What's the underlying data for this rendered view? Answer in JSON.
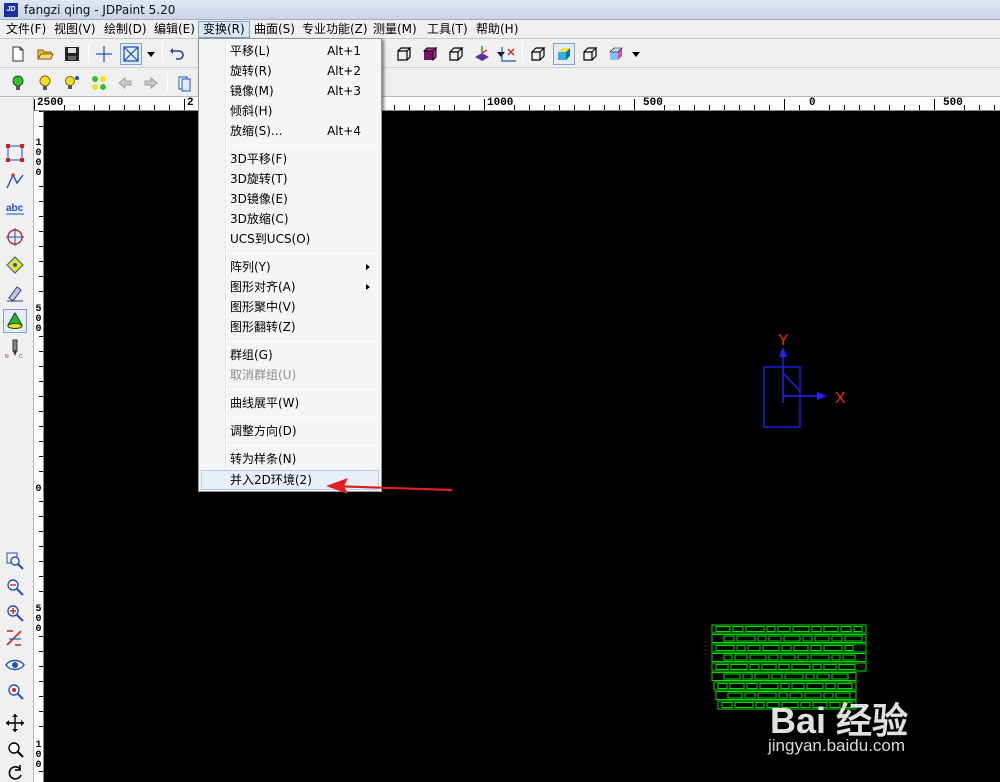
{
  "window": {
    "title": "fangzi qing - JDPaint 5.20",
    "app_icon_text": "JD"
  },
  "menubar": {
    "items": [
      {
        "label": "文件(F)"
      },
      {
        "label": "视图(V)"
      },
      {
        "label": "绘制(D)"
      },
      {
        "label": "编辑(E)"
      },
      {
        "label": "变换(R)"
      },
      {
        "label": "曲面(S)"
      },
      {
        "label": "专业功能(Z)"
      },
      {
        "label": "测量(M)"
      },
      {
        "label": "工具(T)"
      },
      {
        "label": "帮助(H)"
      }
    ],
    "active": "变换(R)"
  },
  "dropdown": {
    "items": [
      {
        "label": "平移(L)",
        "accel": "Alt+1"
      },
      {
        "label": "旋转(R)",
        "accel": "Alt+2"
      },
      {
        "label": "镜像(M)",
        "accel": "Alt+3"
      },
      {
        "label": "倾斜(H)",
        "accel": ""
      },
      {
        "label": "放缩(S)...",
        "accel": "Alt+4"
      },
      {
        "label": "3D平移(F)",
        "accel": ""
      },
      {
        "label": "3D旋转(T)",
        "accel": ""
      },
      {
        "label": "3D镜像(E)",
        "accel": ""
      },
      {
        "label": "3D放缩(C)",
        "accel": ""
      },
      {
        "label": "UCS到UCS(O)",
        "accel": ""
      },
      {
        "label": "阵列(Y)",
        "accel": ""
      },
      {
        "label": "图形对齐(A)",
        "accel": ""
      },
      {
        "label": "图形聚中(V)",
        "accel": ""
      },
      {
        "label": "图形翻转(Z)",
        "accel": ""
      },
      {
        "label": "群组(G)",
        "accel": ""
      },
      {
        "label": "取消群组(U)",
        "accel": "",
        "disabled": true
      },
      {
        "label": "曲线展平(W)",
        "accel": ""
      },
      {
        "label": "调整方向(D)",
        "accel": ""
      },
      {
        "label": "转为样条(N)",
        "accel": ""
      },
      {
        "label": "并入2D环境(2)",
        "accel": "",
        "highlighted": true
      }
    ]
  },
  "ruler": {
    "h_labels": [
      "2500",
      "2",
      "1000",
      "500",
      "0",
      "500"
    ],
    "v_labels": [
      "1\n0\n0\n0",
      "5\n0\n0",
      "0",
      "5\n0\n0",
      "1\n0\n0"
    ]
  },
  "axes": {
    "x_label": "X",
    "y_label": "Y",
    "x_color": "#ff2020",
    "y_color": "#ff2020",
    "axis_color": "#2020ff"
  },
  "colors": {
    "geometry": "#00e000",
    "annotation_arrow": "#e02020"
  },
  "watermark": {
    "logo": "Bai  经验",
    "url": "jingyan.baidu.com"
  }
}
